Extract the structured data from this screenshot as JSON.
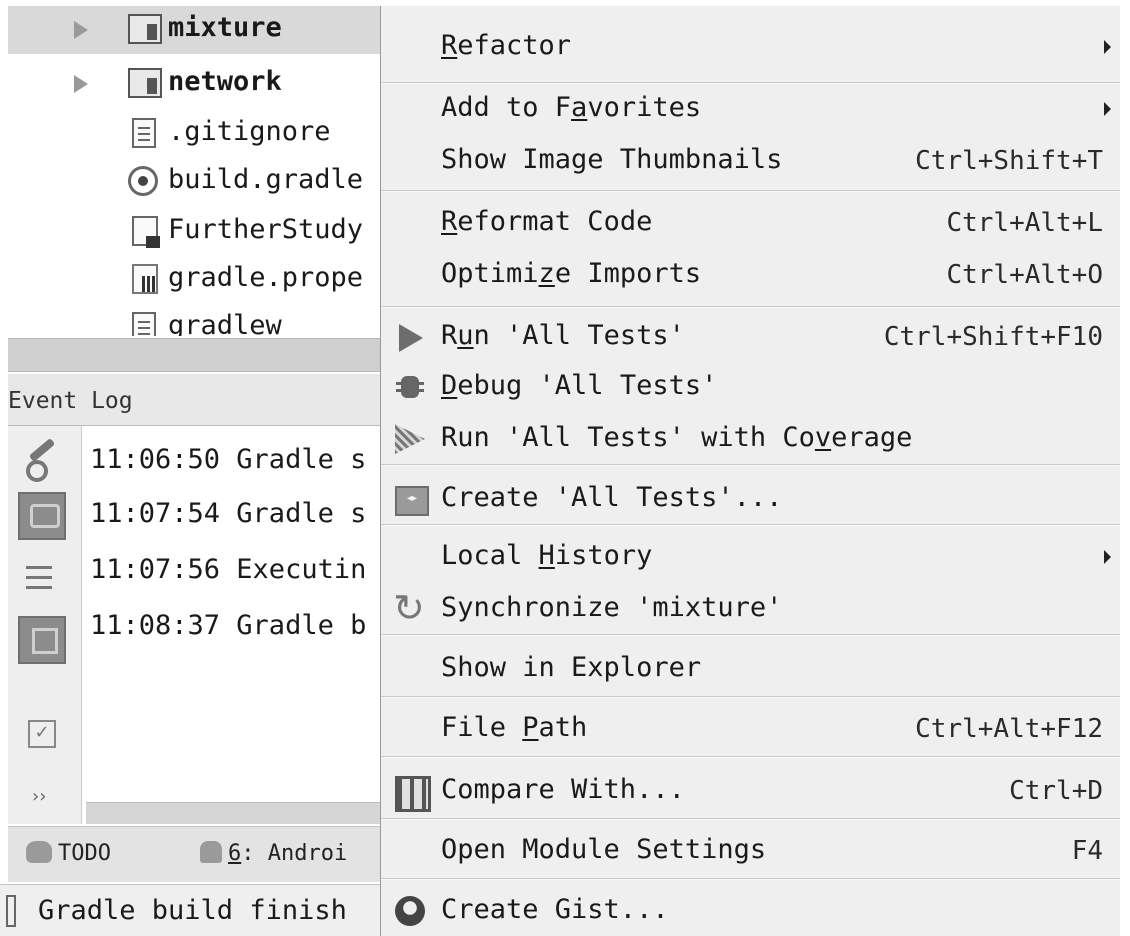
{
  "project_tree": {
    "items": [
      {
        "label": "mixture",
        "type": "folder",
        "bold": true,
        "expandable": true,
        "selected": true
      },
      {
        "label": "network",
        "type": "folder",
        "bold": true,
        "expandable": true,
        "selected": false
      },
      {
        "label": ".gitignore",
        "type": "file"
      },
      {
        "label": "build.gradle",
        "type": "gradle-file"
      },
      {
        "label": "FurtherStudy",
        "type": "module-file"
      },
      {
        "label": "gradle.prope",
        "type": "properties-file"
      },
      {
        "label": "gradlew",
        "type": "file"
      }
    ]
  },
  "event_log": {
    "title": "Event Log",
    "entries": [
      "11:06:50 Gradle s",
      "11:07:54 Gradle s",
      "11:07:56 Executin",
      "11:08:37 Gradle b"
    ],
    "more_label": "››"
  },
  "tool_tabs": {
    "todo": "TODO",
    "android_prefix": "6",
    "android_rest": ": Androi"
  },
  "status_bar": {
    "text": "Gradle build finish"
  },
  "context_menu": {
    "items": {
      "refactor": {
        "pre": "",
        "mnemonic": "R",
        "post": "efactor",
        "shortcut": "",
        "submenu": true
      },
      "add_to_favorites": {
        "pre": "Add to F",
        "mnemonic": "a",
        "post": "vorites",
        "shortcut": "",
        "submenu": true
      },
      "show_image_thumbnails": {
        "pre": "Show Image Thumbnails",
        "mnemonic": "",
        "post": "",
        "shortcut": "Ctrl+Shift+T"
      },
      "reformat_code": {
        "pre": "",
        "mnemonic": "R",
        "post": "eformat Code",
        "shortcut": "Ctrl+Alt+L"
      },
      "optimize_imports": {
        "pre": "Optimi",
        "mnemonic": "z",
        "post": "e Imports",
        "shortcut": "Ctrl+Alt+O"
      },
      "run_all_tests": {
        "pre": "R",
        "mnemonic": "u",
        "post": "n 'All Tests'",
        "shortcut": "Ctrl+Shift+F10",
        "icon": "run-icon"
      },
      "debug_all_tests": {
        "pre": "",
        "mnemonic": "D",
        "post": "ebug 'All Tests'",
        "shortcut": "",
        "icon": "debug-icon"
      },
      "run_with_coverage": {
        "pre": "Run 'All Tests' with Co",
        "mnemonic": "v",
        "post": "erage",
        "shortcut": "",
        "icon": "coverage-icon"
      },
      "create_all_tests": {
        "pre": "Create 'All Tests'...",
        "mnemonic": "",
        "post": "",
        "shortcut": "",
        "icon": "create-test-icon"
      },
      "local_history": {
        "pre": "Local ",
        "mnemonic": "H",
        "post": "istory",
        "shortcut": "",
        "submenu": true
      },
      "synchronize": {
        "pre": "Synchronize 'mixture'",
        "mnemonic": "",
        "post": "",
        "shortcut": "",
        "icon": "sync-icon"
      },
      "show_in_explorer": {
        "pre": "Show in Explorer",
        "mnemonic": "",
        "post": "",
        "shortcut": ""
      },
      "file_path": {
        "pre": "File ",
        "mnemonic": "P",
        "post": "ath",
        "shortcut": "Ctrl+Alt+F12"
      },
      "compare_with": {
        "pre": "Compare With...",
        "mnemonic": "",
        "post": "",
        "shortcut": "Ctrl+D",
        "icon": "compare-icon"
      },
      "open_module_settings": {
        "pre": "Open Module Settings",
        "mnemonic": "",
        "post": "",
        "shortcut": "F4"
      },
      "create_gist": {
        "pre": "Create Gist...",
        "mnemonic": "",
        "post": "",
        "shortcut": "",
        "icon": "github-gist-icon"
      }
    }
  },
  "colors": {
    "menu_background": "#efefef",
    "selection": "#d9d9d9",
    "separator": "#c9c9c9",
    "text": "#1a1a1a"
  }
}
